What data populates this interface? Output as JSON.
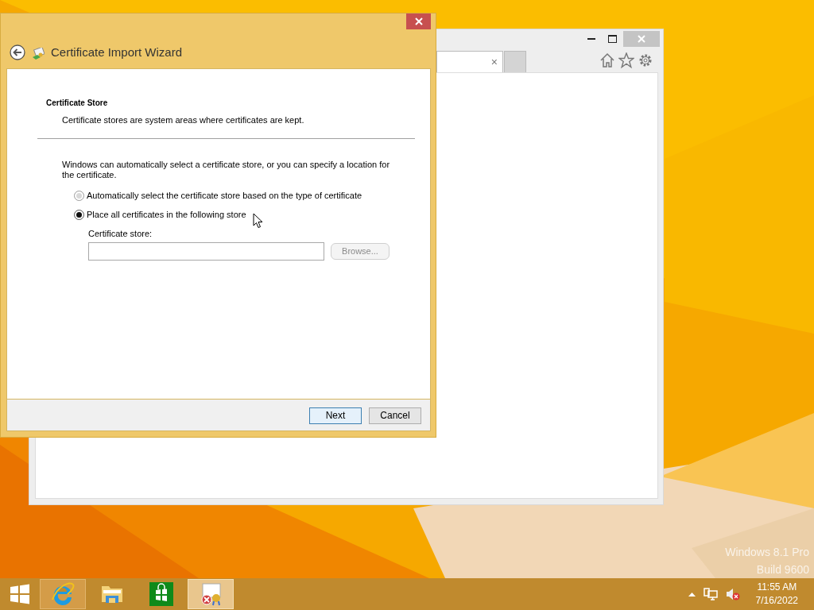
{
  "desktop": {
    "watermark": [
      "Windows 8.1 Pro",
      "Build 9600"
    ]
  },
  "browser_window": {
    "tab_close": "×"
  },
  "dialog": {
    "title": "Certificate Import Wizard",
    "heading": "Certificate Store",
    "subheading": "Certificate stores are system areas where certificates are kept.",
    "intro": "Windows can automatically select a certificate store, or you can specify a location for the certificate.",
    "options": [
      {
        "label": "Automatically select the certificate store based on the type of certificate",
        "selected": false
      },
      {
        "label": "Place all certificates in the following store",
        "selected": true
      }
    ],
    "store_label": "Certificate store:",
    "browse": {
      "label": "Browse...",
      "disabled": true
    },
    "buttons": [
      {
        "label": "Next",
        "default": true
      },
      {
        "label": "Cancel",
        "default": false
      }
    ]
  },
  "taskbar": {
    "apps": [
      {
        "kind": "ie",
        "running": true,
        "selected": false
      },
      {
        "kind": "explorer",
        "running": false,
        "selected": false
      },
      {
        "kind": "store",
        "running": false,
        "selected": false
      },
      {
        "kind": "certificate",
        "running": true,
        "selected": true
      }
    ],
    "volume_muted": true,
    "time": "11:55 AM",
    "date": "7/16/2022"
  }
}
